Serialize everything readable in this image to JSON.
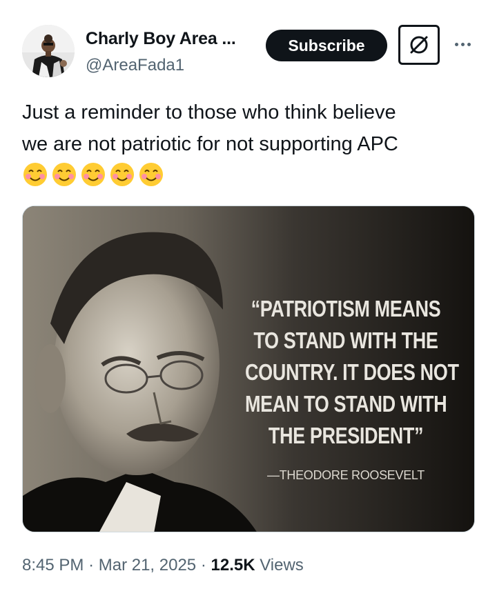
{
  "author": {
    "display_name": "Charly Boy Area ...",
    "handle": "@AreaFada1",
    "avatar_icon": "profile-photo-avatar"
  },
  "actions": {
    "subscribe_label": "Subscribe",
    "grok_icon": "grok-slash-circle-icon",
    "more_icon": "more-dots-icon"
  },
  "tweet": {
    "line1": "Just a reminder to those who think believe",
    "line2": "we are not patriotic for not supporting APC",
    "emojis": [
      "😊",
      "😊",
      "😊",
      "😊",
      "😊"
    ],
    "emoji_count": 5
  },
  "media": {
    "quote_lines": [
      "“PATRIOTISM MEANS",
      "TO STAND WITH THE",
      "COUNTRY. IT DOES NOT",
      "MEAN TO STAND WITH",
      "THE PRESIDENT”"
    ],
    "attribution": "—THEODORE ROOSEVELT"
  },
  "meta": {
    "time": "8:45 PM",
    "separator": "·",
    "date": "Mar 21, 2025",
    "views_count": "12.5K",
    "views_label": "Views"
  },
  "colors": {
    "text_primary": "#0f1419",
    "text_secondary": "#536471",
    "button_dark": "#0f1419",
    "border": "#cfd9de"
  }
}
